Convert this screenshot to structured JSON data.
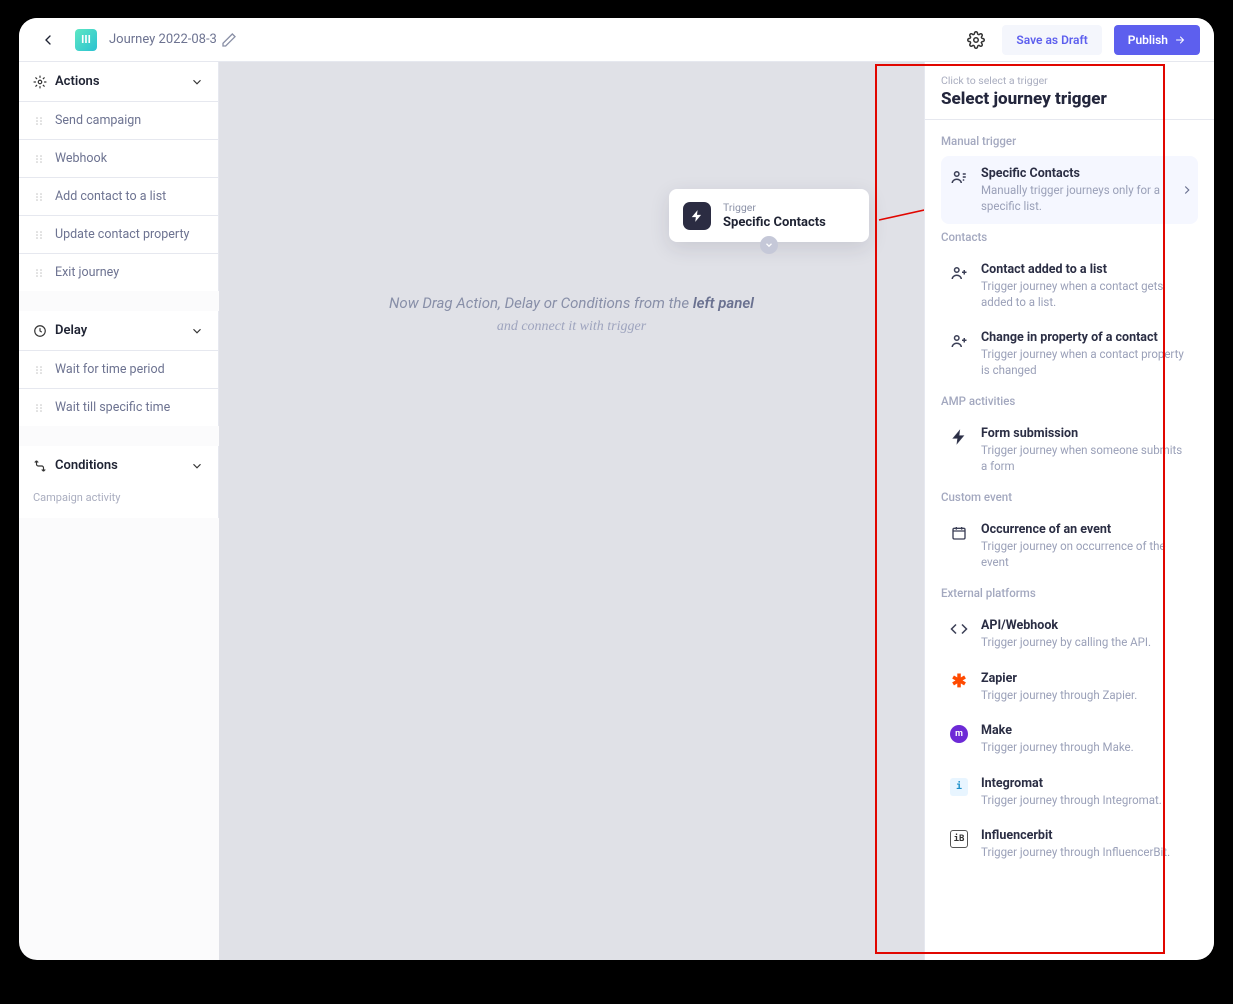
{
  "topbar": {
    "journey_name": "Journey 2022-08-3",
    "save_draft_label": "Save as Draft",
    "publish_label": "Publish"
  },
  "sidebar": {
    "actions": {
      "label": "Actions",
      "items": [
        {
          "label": "Send campaign"
        },
        {
          "label": "Webhook"
        },
        {
          "label": "Add contact to a list"
        },
        {
          "label": "Update contact property"
        },
        {
          "label": "Exit journey"
        }
      ]
    },
    "delay": {
      "label": "Delay",
      "items": [
        {
          "label": "Wait for time period"
        },
        {
          "label": "Wait till specific time"
        }
      ]
    },
    "conditions": {
      "label": "Conditions",
      "subtext": "Campaign activity"
    }
  },
  "canvas": {
    "trigger_eyebrow": "Trigger",
    "trigger_title": "Specific Contacts",
    "hint_line1_a": "Now Drag Action, Delay or Conditions from the",
    "hint_line1_b": "left panel",
    "hint_line2": "and connect it with trigger"
  },
  "right": {
    "crumb": "Click to select a trigger",
    "title": "Select journey trigger",
    "groups": [
      {
        "label": "Manual trigger",
        "options": [
          {
            "title": "Specific Contacts",
            "desc": "Manually trigger journeys only for a specific list.",
            "icon": "contacts",
            "selected": true
          }
        ]
      },
      {
        "label": "Contacts",
        "options": [
          {
            "title": "Contact added to a list",
            "desc": "Trigger journey when a contact gets added to a list.",
            "icon": "person-plus"
          },
          {
            "title": "Change in property of a contact",
            "desc": "Trigger journey when a contact property is changed",
            "icon": "person-plus"
          }
        ]
      },
      {
        "label": "AMP activities",
        "options": [
          {
            "title": "Form submission",
            "desc": "Trigger journey when someone submits a form",
            "icon": "bolt"
          }
        ]
      },
      {
        "label": "Custom event",
        "options": [
          {
            "title": "Occurrence of an event",
            "desc": "Trigger journey on occurrence of the event",
            "icon": "calendar"
          }
        ]
      },
      {
        "label": "External platforms",
        "options": [
          {
            "title": "API/Webhook",
            "desc": "Trigger journey by calling the API.",
            "icon": "code"
          },
          {
            "title": "Zapier",
            "desc": "Trigger journey through Zapier.",
            "icon": "zapier"
          },
          {
            "title": "Make",
            "desc": "Trigger journey through Make.",
            "icon": "make"
          },
          {
            "title": "Integromat",
            "desc": "Trigger journey through Integromat.",
            "icon": "integromat"
          },
          {
            "title": "Influencerbit",
            "desc": "Trigger journey through InfluencerBit.",
            "icon": "influencerbit"
          }
        ]
      }
    ]
  }
}
